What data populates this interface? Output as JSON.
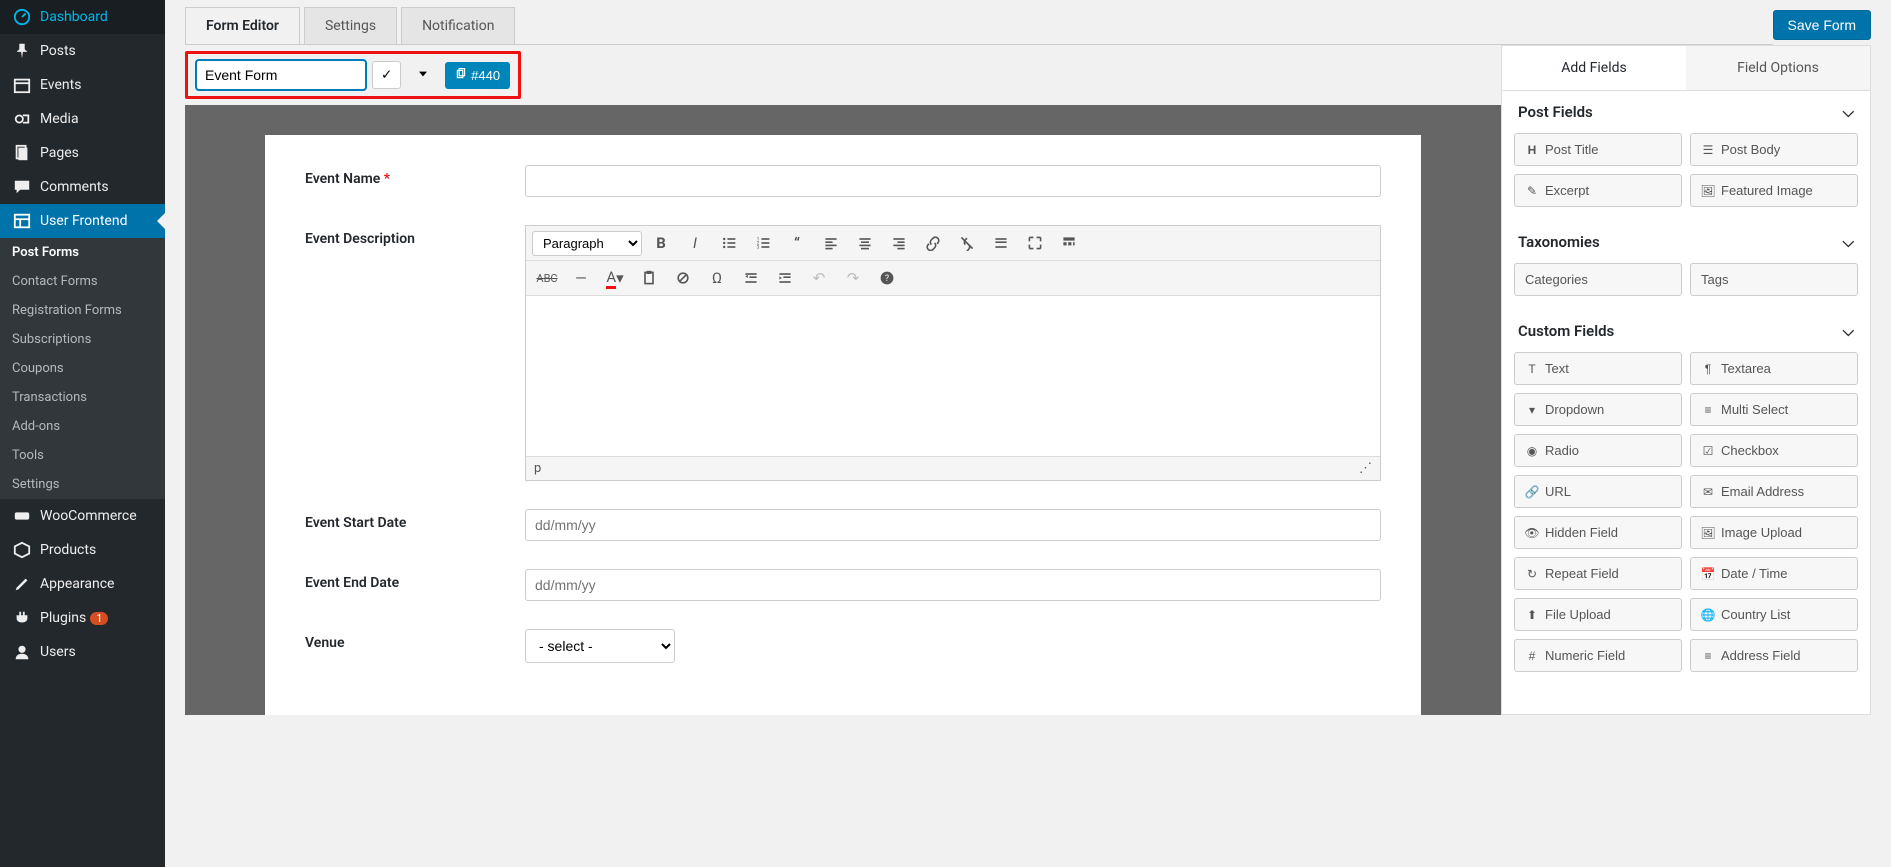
{
  "sidebar": {
    "items": [
      {
        "label": "Dashboard",
        "icon": "dashboard"
      },
      {
        "label": "Posts",
        "icon": "pin"
      },
      {
        "label": "Events",
        "icon": "calendar"
      },
      {
        "label": "Media",
        "icon": "media"
      },
      {
        "label": "Pages",
        "icon": "page"
      },
      {
        "label": "Comments",
        "icon": "comment"
      },
      {
        "label": "User Frontend",
        "icon": "layout"
      },
      {
        "label": "WooCommerce",
        "icon": "woo"
      },
      {
        "label": "Products",
        "icon": "package"
      },
      {
        "label": "Appearance",
        "icon": "brush"
      },
      {
        "label": "Plugins",
        "icon": "plug"
      },
      {
        "label": "Users",
        "icon": "user"
      }
    ],
    "submenu": [
      "Post Forms",
      "Contact Forms",
      "Registration Forms",
      "Subscriptions",
      "Coupons",
      "Transactions",
      "Add-ons",
      "Tools",
      "Settings"
    ],
    "plugins_badge": "1"
  },
  "tabs": [
    "Form Editor",
    "Settings",
    "Notification"
  ],
  "save_button": "Save Form",
  "form_title": "Event Form",
  "form_id": "#440",
  "form_fields": {
    "event_name": {
      "label": "Event Name",
      "required": true
    },
    "event_desc": {
      "label": "Event Description"
    },
    "start_date": {
      "label": "Event Start Date",
      "placeholder": "dd/mm/yy"
    },
    "end_date": {
      "label": "Event End Date",
      "placeholder": "dd/mm/yy"
    },
    "venue": {
      "label": "Venue",
      "select": "- select -"
    }
  },
  "rte": {
    "format": "Paragraph",
    "status": "p"
  },
  "panel": {
    "tabs": [
      "Add Fields",
      "Field Options"
    ],
    "sections": {
      "post_fields": {
        "title": "Post Fields",
        "items": [
          "Post Title",
          "Post Body",
          "Excerpt",
          "Featured Image"
        ]
      },
      "taxonomies": {
        "title": "Taxonomies",
        "items": [
          "Categories",
          "Tags"
        ]
      },
      "custom_fields": {
        "title": "Custom Fields",
        "items": [
          "Text",
          "Textarea",
          "Dropdown",
          "Multi Select",
          "Radio",
          "Checkbox",
          "URL",
          "Email Address",
          "Hidden Field",
          "Image Upload",
          "Repeat Field",
          "Date / Time",
          "File Upload",
          "Country List",
          "Numeric Field",
          "Address Field"
        ]
      }
    }
  }
}
